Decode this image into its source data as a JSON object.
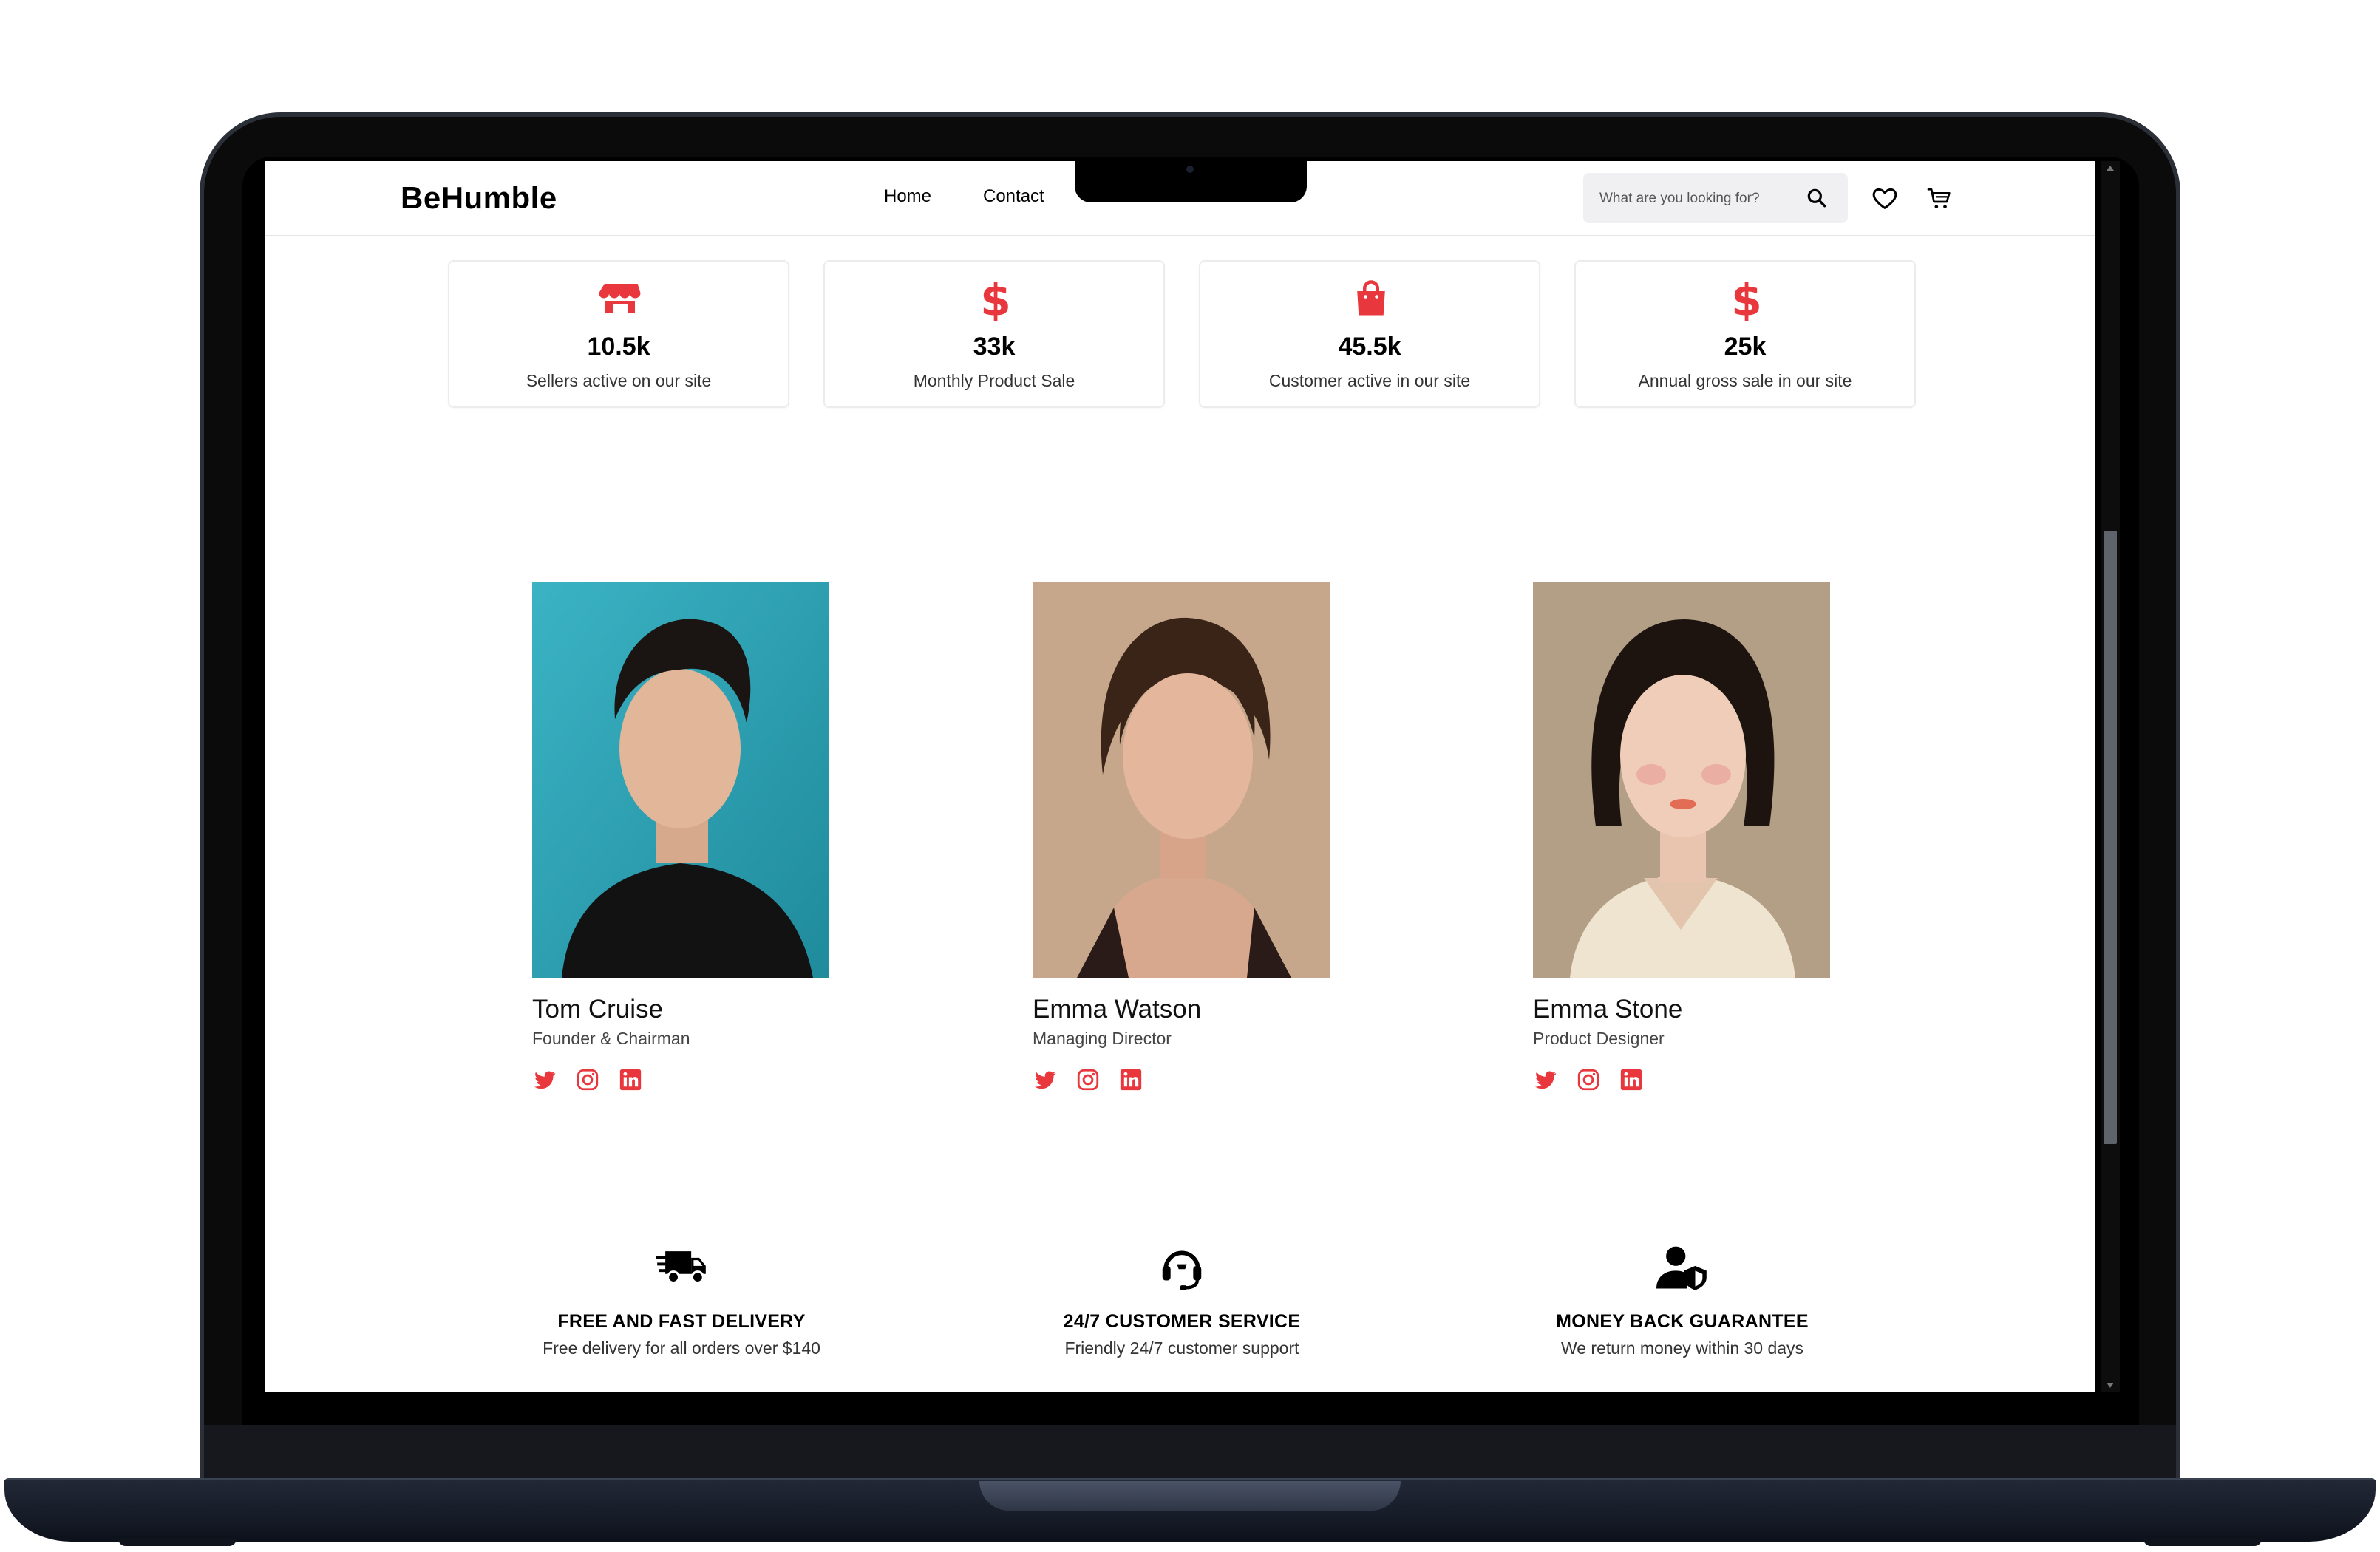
{
  "brand": "BeHumble",
  "nav": {
    "links": [
      "Home",
      "Contact"
    ],
    "search_placeholder": "What are you looking for?",
    "icons": [
      "search-icon",
      "heart-icon",
      "cart-icon"
    ]
  },
  "stats": [
    {
      "icon": "shop-icon",
      "value": "10.5k",
      "label": "Sellers active on our site"
    },
    {
      "icon": "dollar-icon",
      "value": "33k",
      "label": "Monthly Product Sale"
    },
    {
      "icon": "shopping-bag-icon",
      "value": "45.5k",
      "label": "Customer active in our site"
    },
    {
      "icon": "dollar-icon",
      "value": "25k",
      "label": "Annual gross sale in our site"
    }
  ],
  "team": [
    {
      "name": "Tom Cruise",
      "role": "Founder & Chairman",
      "socials": [
        "twitter-icon",
        "instagram-icon",
        "linkedin-icon"
      ]
    },
    {
      "name": "Emma Watson",
      "role": "Managing Director",
      "socials": [
        "twitter-icon",
        "instagram-icon",
        "linkedin-icon"
      ]
    },
    {
      "name": "Emma Stone",
      "role": "Product Designer",
      "socials": [
        "twitter-icon",
        "instagram-icon",
        "linkedin-icon"
      ]
    }
  ],
  "features": [
    {
      "icon": "delivery-truck-icon",
      "title": "FREE AND FAST DELIVERY",
      "subtitle": "Free delivery for all orders over $140"
    },
    {
      "icon": "headset-icon",
      "title": "24/7 CUSTOMER SERVICE",
      "subtitle": "Friendly 24/7 customer support"
    },
    {
      "icon": "user-shield-icon",
      "title": "MONEY BACK GUARANTEE",
      "subtitle": "We return money within 30 days"
    }
  ],
  "colors": {
    "accent": "#e8383d",
    "text": "#000000",
    "search_bg": "#f0f0f2"
  }
}
